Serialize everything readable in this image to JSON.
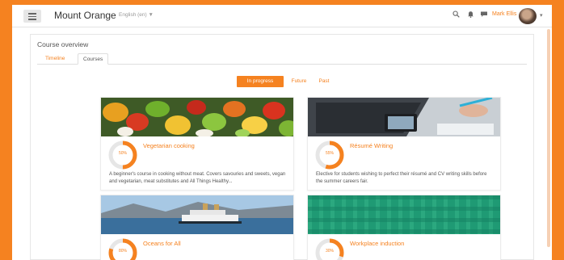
{
  "header": {
    "site_name": "Mount Orange",
    "language": "English (en) ▼",
    "user_name": "Mark Ellis",
    "icons": [
      "menu-icon",
      "search-icon",
      "bell-icon",
      "message-icon",
      "avatar",
      "caret-down-icon"
    ]
  },
  "overview": {
    "title": "Course overview",
    "tabs": [
      "Timeline",
      "Courses"
    ],
    "active_tab": "Courses"
  },
  "filters": {
    "items": [
      "In progress",
      "Future",
      "Past"
    ],
    "active": "In progress"
  },
  "courses": [
    {
      "title": "Vegetarian cooking",
      "progress_label": "50%",
      "progress": 0.5,
      "description": "A beginner's course in cooking without meat. Covers savouries and sweets, vegan and vegetarian, meat substitutes and All Things Healthy...",
      "image": "vegetables-image"
    },
    {
      "title": "Résumé Writing",
      "progress_label": "55%",
      "progress": 0.55,
      "description": "Elective for students wishing to perfect their résumé and CV writing skills before the summer careers fair.",
      "image": "laptop-image"
    },
    {
      "title": "Oceans for All",
      "progress_label": "80%",
      "progress": 0.8,
      "description": "",
      "image": "steamboat-image"
    },
    {
      "title": "Workplace induction",
      "progress_label": "30%",
      "progress": 0.3,
      "description": "",
      "image": "green-pattern-image"
    }
  ],
  "colors": {
    "accent": "#f58220",
    "progress_track": "#e6e6e6"
  }
}
